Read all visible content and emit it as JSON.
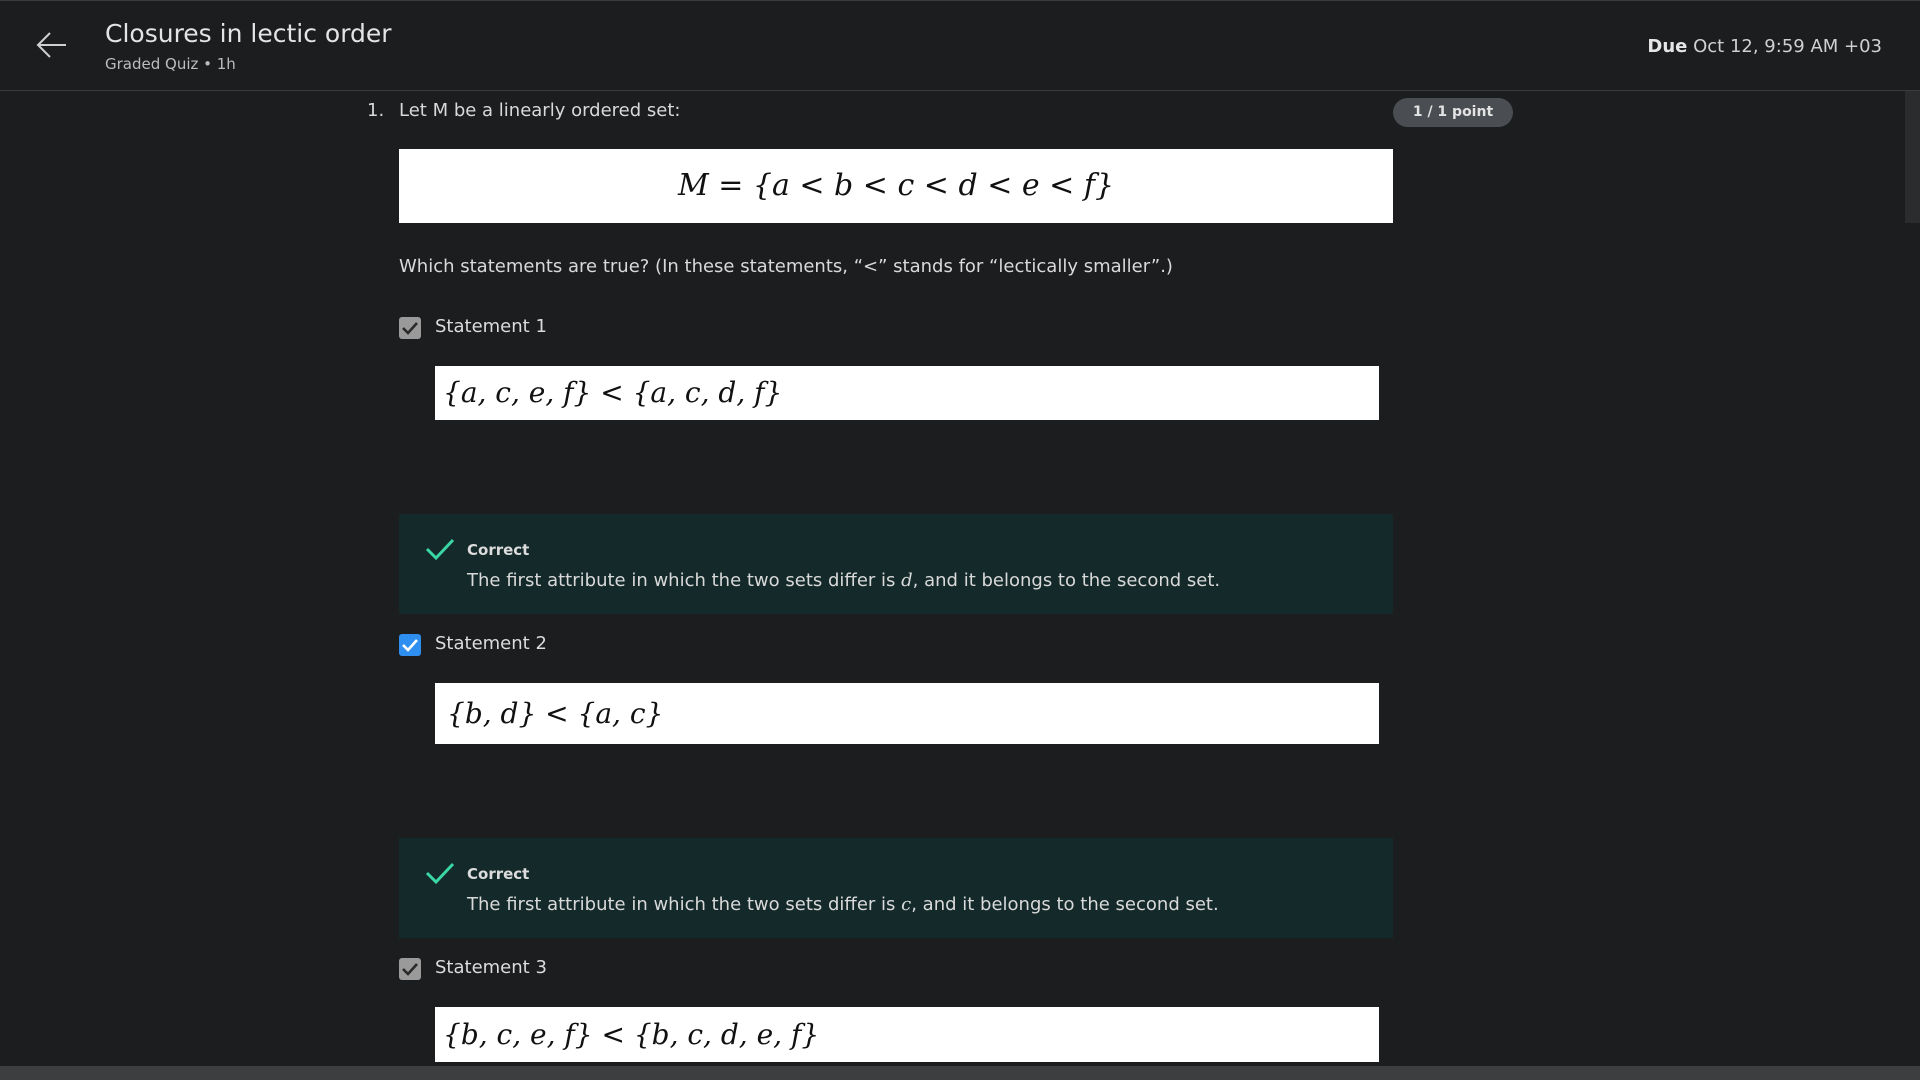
{
  "header": {
    "title": "Closures in lectic order",
    "subtitle": "Graded Quiz • 1h",
    "due_label": "Due",
    "due_value": "Oct 12, 9:59 AM +03"
  },
  "question": {
    "number": "1.",
    "text": "Let M be a linearly ordered set:",
    "points_badge": "1 / 1 point",
    "set_formula": "M = {a < b < c < d < e < f}",
    "prompt": "Which statements are true? (In these statements, “<” stands for “lectically smaller”.)"
  },
  "statements": [
    {
      "label": "Statement 1",
      "formula": "{a, c, e, f} < {a, c, d, f}",
      "checkbox_color": "gray",
      "feedback_title": "Correct",
      "feedback_pre": "The first attribute in which the two sets differ is ",
      "feedback_var": "d",
      "feedback_post": ", and it belongs to the second set."
    },
    {
      "label": "Statement 2",
      "formula": "{b, d} < {a, c}",
      "checkbox_color": "blue",
      "feedback_title": "Correct",
      "feedback_pre": "The first attribute in which the two sets differ is ",
      "feedback_var": "c",
      "feedback_post": ", and it belongs to the second set."
    },
    {
      "label": "Statement 3",
      "formula": "{b, c, e, f} < {b, c, d, e, f}",
      "checkbox_color": "gray"
    }
  ],
  "colors": {
    "background": "#1c1d1f",
    "feedback_bg": "#14292a",
    "check_green": "#3ad6a4",
    "checkbox_blue": "#2f8ff0",
    "checkbox_gray": "#9a9a9a",
    "badge_bg": "#4a4d52"
  },
  "icons": {
    "back": "arrow-left-icon",
    "feedback": "check-icon",
    "checkbox": "checkmark-icon"
  }
}
